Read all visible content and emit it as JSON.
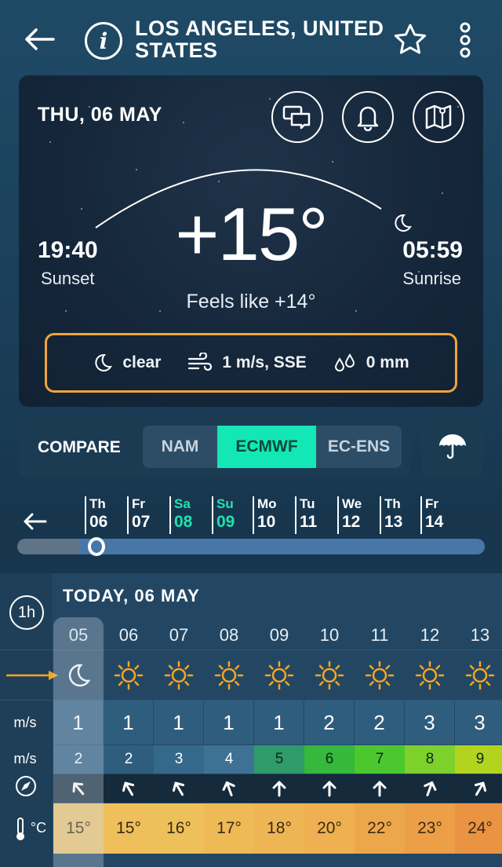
{
  "header": {
    "title": "LOS ANGELES, UNITED STATES"
  },
  "card": {
    "date": "THU, 06 MAY",
    "temperature": "+15°",
    "feels_like": "Feels like +14°",
    "sunset_time": "19:40",
    "sunset_label": "Sunset",
    "sunrise_time": "05:59",
    "sunrise_label": "Sunrise",
    "conditions": {
      "sky": "clear",
      "wind": "1 m/s, SSE",
      "precip": "0 mm"
    }
  },
  "compare": {
    "label": "COMPARE",
    "models": [
      {
        "label": "NAM"
      },
      {
        "label": "ECMWF"
      },
      {
        "label": "EC-ENS"
      }
    ],
    "selected": "ECMWF"
  },
  "days": [
    {
      "dn": "Th",
      "dd": "06"
    },
    {
      "dn": "Fr",
      "dd": "07"
    },
    {
      "dn": "Sa",
      "dd": "08"
    },
    {
      "dn": "Su",
      "dd": "09"
    },
    {
      "dn": "Mo",
      "dd": "10"
    },
    {
      "dn": "Tu",
      "dd": "11"
    },
    {
      "dn": "We",
      "dd": "12"
    },
    {
      "dn": "Th",
      "dd": "13"
    },
    {
      "dn": "Fr",
      "dd": "14"
    }
  ],
  "range_knob_label": "0",
  "grid": {
    "interval": "1h",
    "today": "TODAY, 06 MAY",
    "wind_unit": "m/s",
    "gust_unit": "m/s",
    "temp_unit": "°C",
    "hours": [
      "05",
      "06",
      "07",
      "08",
      "09",
      "10",
      "11",
      "12",
      "13"
    ],
    "icons": [
      "moon-icon",
      "sun-icon",
      "sun-icon",
      "sun-icon",
      "sun-icon",
      "sun-icon",
      "sun-icon",
      "sun-icon",
      "sun-icon"
    ],
    "wind": [
      "1",
      "1",
      "1",
      "1",
      "1",
      "2",
      "2",
      "3",
      "3"
    ],
    "gusts": [
      "2",
      "2",
      "3",
      "4",
      "5",
      "6",
      "7",
      "8",
      "9"
    ],
    "gust_colors": [
      "#2f5d7e",
      "#2f5d7e",
      "#35698c",
      "#3d7295",
      "#2f9a6a",
      "#35b83c",
      "#4cc72e",
      "#7cd12a",
      "#b2d41f"
    ],
    "dir_deg": [
      -40,
      -30,
      -30,
      -20,
      0,
      0,
      0,
      20,
      30
    ],
    "temps": [
      "15°",
      "15°",
      "16°",
      "17°",
      "18°",
      "20°",
      "22°",
      "23°",
      "24°"
    ],
    "temp_colors": [
      "#f0c36a",
      "#eebf5b",
      "#eec05a",
      "#edba55",
      "#edb553",
      "#eeb050",
      "#eda74b",
      "#ec9f46",
      "#ea9342"
    ]
  },
  "colors": {
    "accent": "#14e7b6",
    "highlight_border": "#f0a53a",
    "sun": "#f5a623"
  }
}
